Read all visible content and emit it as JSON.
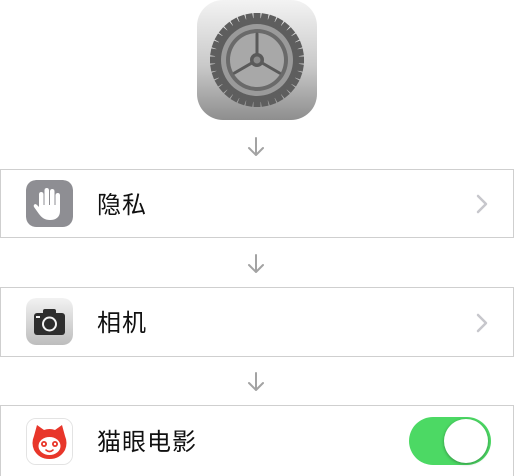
{
  "app_icon": {
    "icon": "settings-gear-icon"
  },
  "flow_arrow_icon": "down-arrow-icon",
  "rows": [
    {
      "label": "隐私",
      "icon": "privacy-hand-icon",
      "accessory": "chevron"
    },
    {
      "label": "相机",
      "icon": "camera-icon",
      "accessory": "chevron"
    },
    {
      "label": "猫眼电影",
      "icon": "maoyan-cat-icon",
      "accessory": "toggle",
      "toggle_on": true
    }
  ],
  "colors": {
    "toggle_on": "#4cd964",
    "maoyan_red": "#e8362a",
    "privacy_gray": "#8e8e93",
    "row_border": "#cfcfcf"
  }
}
